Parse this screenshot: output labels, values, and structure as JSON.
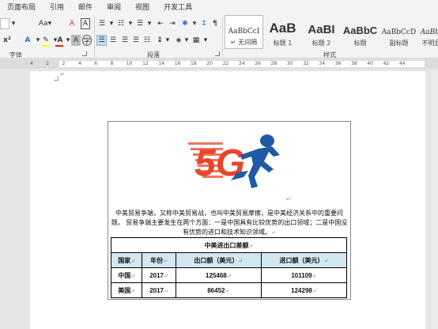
{
  "ribbon_tabs": [
    "页面布局",
    "引用",
    "邮件",
    "审阅",
    "视图",
    "开发工具"
  ],
  "font_group": {
    "label": "字体",
    "font_size_button": "Aa",
    "clear_format": "A",
    "text_effect": "A",
    "font_color": "A",
    "char_shade": "A",
    "enclose_char": "字",
    "char_border": "A",
    "accent_color_highlight": "#ffff00",
    "accent_color_font": "#e02020"
  },
  "paragraph_group": {
    "label": "段落"
  },
  "styles_group": {
    "label": "样式",
    "items": [
      {
        "sample": "AaBbCcI",
        "name": "无间隔"
      },
      {
        "sample": "AaB",
        "name": "标题 1"
      },
      {
        "sample": "AaBI",
        "name": "标题 2"
      },
      {
        "sample": "AaBbC",
        "name": "标题"
      },
      {
        "sample": "AaBbCcD",
        "name": "副标题"
      },
      {
        "sample": "AaBbCcD",
        "name": "不明显强调"
      }
    ],
    "first_prefix": "↵"
  },
  "ruler": {
    "numbers": [
      "4",
      "2",
      "2",
      "4",
      "6",
      "8",
      "10",
      "12",
      "14",
      "16",
      "18",
      "20",
      "22",
      "24",
      "26",
      "28",
      "30",
      "32",
      "34",
      "36",
      "38",
      "40",
      "42",
      "44"
    ]
  },
  "logo": {
    "text": "5G",
    "primary_color": "#e8452c",
    "figure_color": "#1f5aa6"
  },
  "document": {
    "paragraph": "中美贸易争端，又称中美贸易战，也叫中美贸易摩擦，是中美经济关系中的重要问题。 贸易争端主要发生在两个方面：一是中国具有比较优势的出口领域；二是中国没有优势的进口和技术知识领域。",
    "para_mark": "↵",
    "table": {
      "title": "中美进出口差额",
      "headers": [
        "国家",
        "年份",
        "出口额（美元）",
        "进口额（美元）"
      ],
      "rows": [
        [
          "中国",
          "2017",
          "125468",
          "101109"
        ],
        [
          "美国",
          "2017",
          "86452",
          "124298"
        ]
      ]
    }
  }
}
